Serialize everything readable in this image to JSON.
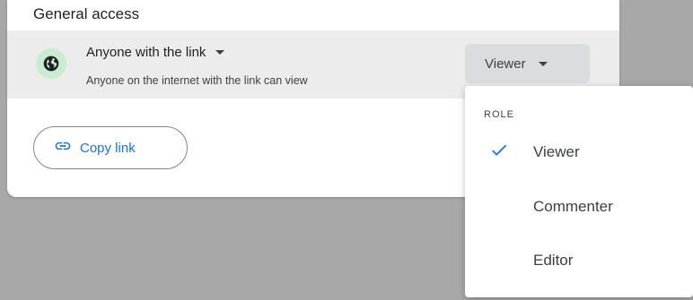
{
  "general_access": {
    "title": "General access",
    "access_option": "Anyone with the link",
    "access_description": "Anyone on the internet with the link can view",
    "role_button_label": "Viewer",
    "copy_link_label": "Copy link"
  },
  "role_menu": {
    "heading": "ROLE",
    "items": [
      {
        "label": "Viewer",
        "selected": true
      },
      {
        "label": "Commenter",
        "selected": false
      },
      {
        "label": "Editor",
        "selected": false
      }
    ]
  },
  "colors": {
    "accent": "#1a73e8",
    "globe_badge_bg": "#c9eccf",
    "backdrop": "#a8a8a8"
  },
  "icons": {
    "globe": "globe-icon",
    "caret": "caret-down-icon",
    "link": "link-icon",
    "check": "check-icon"
  }
}
